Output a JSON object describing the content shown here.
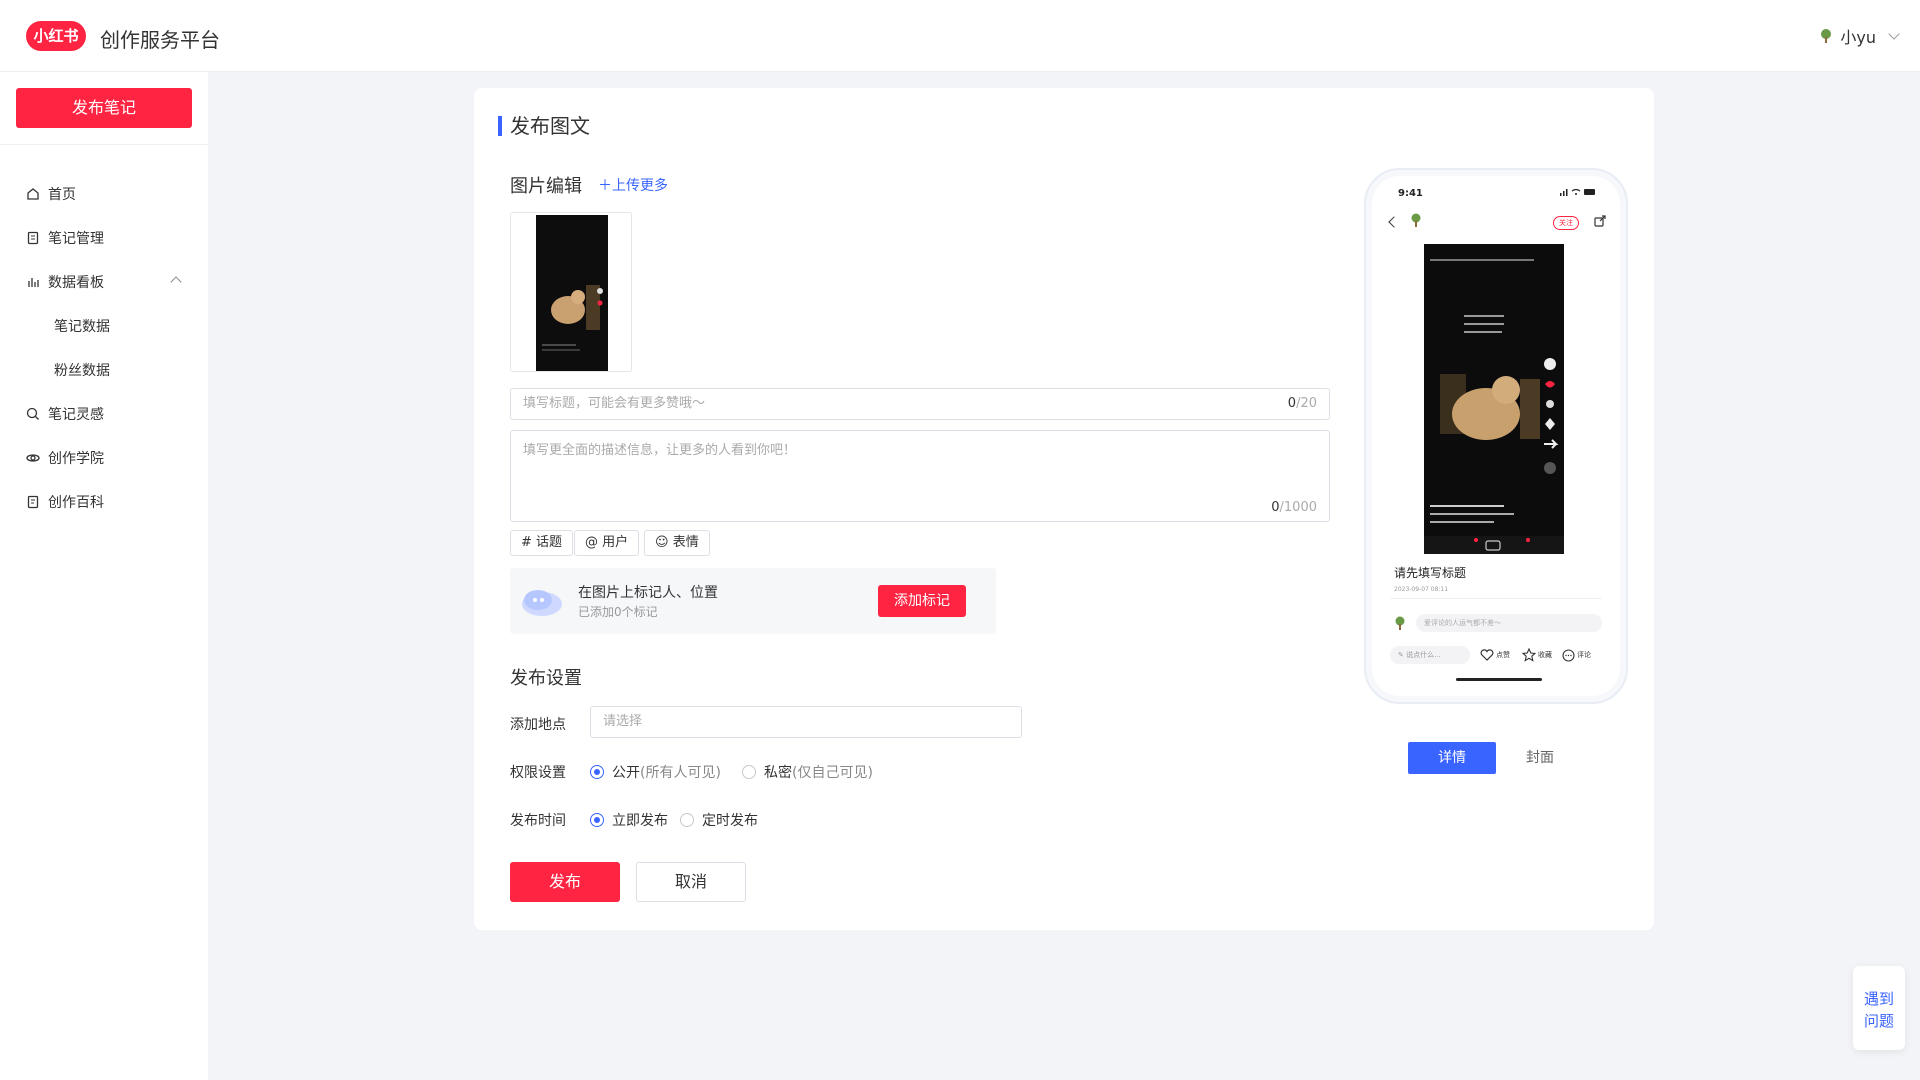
{
  "header": {
    "logo_text": "小红书",
    "app_title": "创作服务平台",
    "user_name": "小yu"
  },
  "sidebar": {
    "publish_label": "发布笔记",
    "items": [
      {
        "label": "首页",
        "icon": "home-icon"
      },
      {
        "label": "笔记管理",
        "icon": "note-icon"
      },
      {
        "label": "数据看板",
        "icon": "chart-icon"
      },
      {
        "label": "笔记数据"
      },
      {
        "label": "粉丝数据"
      },
      {
        "label": "笔记灵感",
        "icon": "inspiration-icon"
      },
      {
        "label": "创作学院",
        "icon": "academy-icon"
      },
      {
        "label": "创作百科",
        "icon": "wiki-icon"
      }
    ]
  },
  "main": {
    "page_title": "发布图文",
    "image_section_title": "图片编辑",
    "upload_more": "上传更多",
    "title_placeholder": "填写标题，可能会有更多赞哦～",
    "title_count": "0",
    "title_max": "/20",
    "desc_placeholder": "填写更全面的描述信息，让更多的人看到你吧！",
    "desc_count": "0",
    "desc_max": "/1000",
    "tags": [
      "# 话题",
      "@ 用户",
      "表情"
    ],
    "mark_title": "在图片上标记人、位置",
    "mark_sub": "已添加0个标记",
    "add_mark": "添加标记",
    "publish_settings_title": "发布设置",
    "location_label": "添加地点",
    "location_placeholder": "请选择",
    "permission_label": "权限设置",
    "permission_public": "公开",
    "permission_public_note": "(所有人可见)",
    "permission_private": "私密",
    "permission_private_note": "(仅自己可见)",
    "time_label": "发布时间",
    "time_now": "立即发布",
    "time_scheduled": "定时发布",
    "publish": "发布",
    "cancel": "取消"
  },
  "preview": {
    "time": "9:41",
    "follow": "关注",
    "title": "请先填写标题",
    "date": "2023-09-07 08:11",
    "comment_placeholder": "爱评论的人运气都不差～",
    "say": "说点什么...",
    "like": "点赞",
    "collect": "收藏",
    "comment": "评论",
    "tab_detail": "详情",
    "tab_cover": "封面"
  },
  "help": {
    "line1": "遇到",
    "line2": "问题"
  },
  "colors": {
    "brand_red": "#ff2442",
    "accent_blue": "#3a64ff"
  }
}
